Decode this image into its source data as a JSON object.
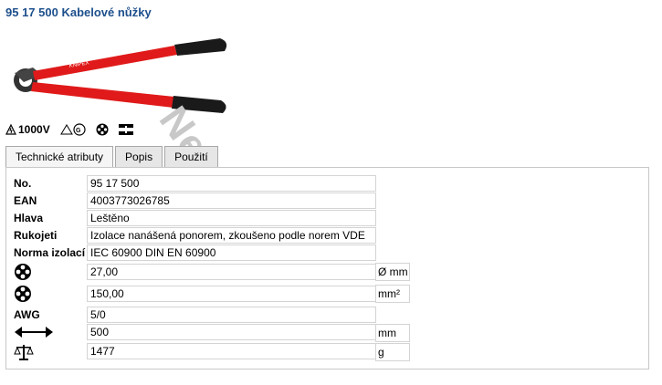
{
  "title": "95 17 500 Kabelové nůžky",
  "watermark": "Nerezka",
  "certifications": {
    "voltage": "1000V",
    "icons": [
      "insulated-glove-icon",
      "gs-mark-icon",
      "cable-cross-section-icon",
      "cut-symbol-icon"
    ]
  },
  "tabs": [
    {
      "label": "Technické atributy",
      "active": true
    },
    {
      "label": "Popis",
      "active": false
    },
    {
      "label": "Použití",
      "active": false
    }
  ],
  "attributes": {
    "no": {
      "label": "No.",
      "value": "95 17 500"
    },
    "ean": {
      "label": "EAN",
      "value": "4003773026785"
    },
    "hlava": {
      "label": "Hlava",
      "value": "Leštěno"
    },
    "rukojeti": {
      "label": "Rukojeti",
      "value": "Izolace nanášená ponorem, zkoušeno podle norem VDE"
    },
    "norma": {
      "label": "Norma izolací",
      "value": "IEC 60900 DIN EN 60900"
    },
    "diameter": {
      "icon": "cable-diameter-icon",
      "value": "27,00",
      "unit": "Ø mm"
    },
    "cross_section": {
      "icon": "cable-cross-section-icon",
      "value": "150,00",
      "unit": "mm²"
    },
    "awg": {
      "label": "AWG",
      "value": "5/0"
    },
    "length": {
      "icon": "length-arrow-icon",
      "value": "500",
      "unit": "mm"
    },
    "weight": {
      "icon": "weight-scale-icon",
      "value": "1477",
      "unit": "g"
    }
  },
  "colors": {
    "title": "#1d4f8c",
    "handle_red": "#e01a1a",
    "grip_black": "#1a1a1a"
  }
}
